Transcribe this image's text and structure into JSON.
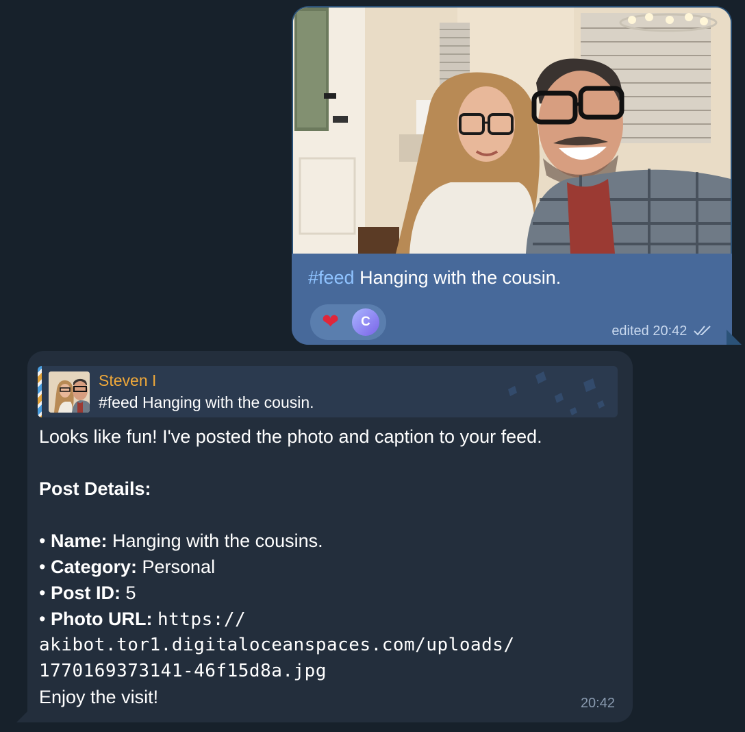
{
  "outgoing": {
    "caption_hashtag": "#feed",
    "caption_text": " Hanging with the cousin.",
    "reaction": {
      "emoji_icon": "heart-icon",
      "emoji": "❤",
      "avatar_initial": "C"
    },
    "edited_label": "edited",
    "time": "20:42",
    "status_icon": "double-check-icon",
    "bubble_color": "#2b5278",
    "caption_bg_color": "#47699a",
    "hashtag_color": "#8fc3ff"
  },
  "incoming": {
    "reply": {
      "sender": "Steven I",
      "text": "#feed Hanging with the cousin.",
      "sender_color": "#f0a93a"
    },
    "intro": "Looks like fun! I've posted the photo and caption to your feed.",
    "details_heading": "Post Details:",
    "details": [
      {
        "bullet": "• ",
        "label": "Name:",
        "value": " Hanging with the cousins."
      },
      {
        "bullet": "• ",
        "label": "Category:",
        "value": " Personal"
      },
      {
        "bullet": "• ",
        "label": "Post ID:",
        "value": " 5"
      },
      {
        "bullet": "• ",
        "label": "Photo URL:",
        "value": " "
      }
    ],
    "url_lines": [
      "https://",
      "akibot.tor1.digitaloceanspaces.com/uploads/",
      "1770169373141-46f15d8a.jpg"
    ],
    "closing": "Enjoy the visit!",
    "time": "20:42",
    "bubble_color": "#232e3c"
  },
  "background_color": "#17212b"
}
